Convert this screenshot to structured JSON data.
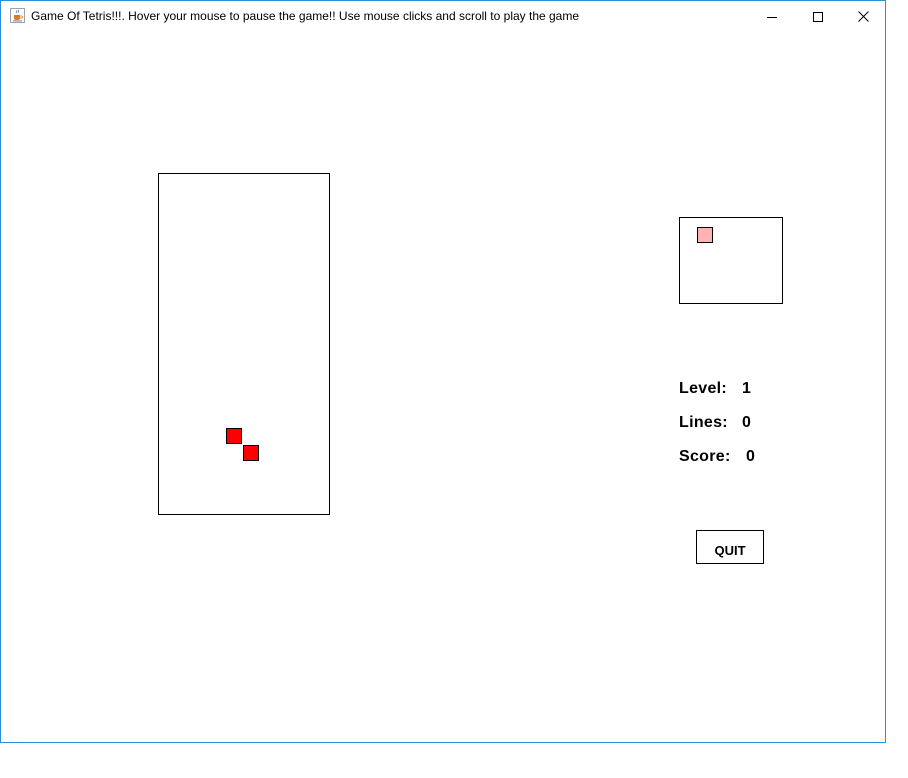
{
  "window": {
    "title": "Game Of Tetris!!!. Hover your mouse to pause the game!! Use mouse clicks and scroll to play the game",
    "app_icon": "java-coffee-cup-icon",
    "controls": {
      "minimize_icon": "minimize-icon",
      "maximize_icon": "maximize-icon",
      "close_icon": "close-icon"
    },
    "border_color": "#2b8fd9"
  },
  "game": {
    "active_piece": {
      "shape": "Z",
      "color": "#ff0000"
    },
    "next_piece": {
      "color": "#ffb3b3"
    }
  },
  "stats": {
    "level_label": "Level:",
    "level_value": "1",
    "lines_label": "Lines:",
    "lines_value": "0",
    "score_label": "Score:",
    "score_value": "0"
  },
  "buttons": {
    "quit_label": "QUIT"
  }
}
